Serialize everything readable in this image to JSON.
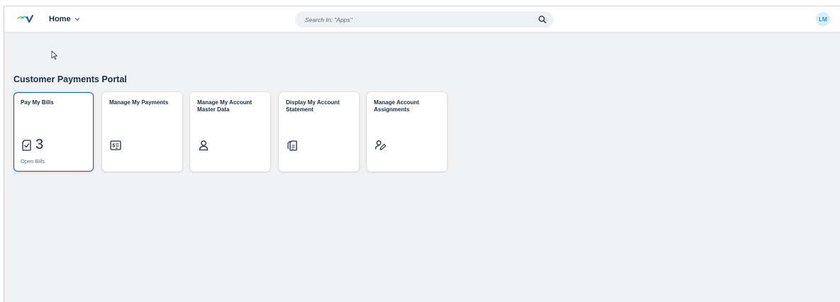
{
  "shell": {
    "home_label": "Home",
    "search_placeholder": "Search In: \"Apps\"",
    "user_initials": "LM"
  },
  "group": {
    "title": "Customer Payments Portal"
  },
  "tiles": [
    {
      "title": "Pay My Bills",
      "icon": "bill-check-icon",
      "count": "3",
      "footer": "Open Bills",
      "active": true
    },
    {
      "title": "Manage My Payments",
      "icon": "payment-card-icon"
    },
    {
      "title": "Manage My Account Master Data",
      "icon": "person-icon"
    },
    {
      "title": "Display My Account Statement",
      "icon": "documents-icon"
    },
    {
      "title": "Manage Account Assignments",
      "icon": "person-edit-icon"
    }
  ],
  "colors": {
    "accent": "#0064d9",
    "background": "#f1f2f3",
    "avatar_bg": "#d1efff"
  }
}
